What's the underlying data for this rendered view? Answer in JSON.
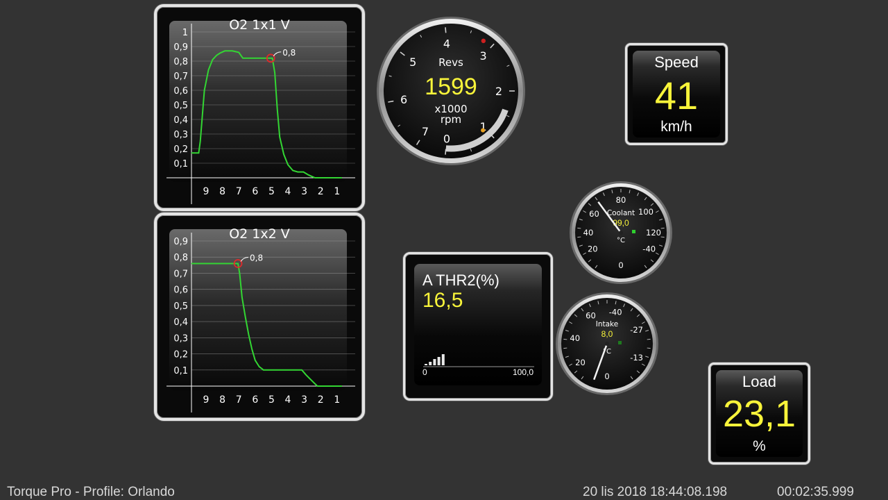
{
  "o2_chart_1": {
    "title": "O2 1x1  V",
    "y_ticks": [
      "1",
      "0,9",
      "0,8",
      "0,7",
      "0,6",
      "0,5",
      "0,4",
      "0,3",
      "0,2",
      "0,1"
    ],
    "x_ticks": [
      "9",
      "8",
      "7",
      "6",
      "5",
      "4",
      "3",
      "2",
      "1"
    ],
    "marker_label": "0,8",
    "line_color": "#33d633"
  },
  "o2_chart_2": {
    "title": "O2 1x2  V",
    "y_ticks": [
      "0,9",
      "0,8",
      "0,7",
      "0,6",
      "0,5",
      "0,4",
      "0,3",
      "0,2",
      "0,1"
    ],
    "x_ticks": [
      "9",
      "8",
      "7",
      "6",
      "5",
      "4",
      "3",
      "2",
      "1"
    ],
    "marker_label": "0,8",
    "line_color": "#33d633"
  },
  "chart_data": [
    {
      "type": "line",
      "title": "O2 1x1  V",
      "ylim": [
        0,
        1
      ],
      "xlim": [
        9.5,
        0.5
      ],
      "x": [
        9.9,
        9.45,
        9.35,
        9.1,
        8.85,
        8.6,
        8.35,
        8.15,
        7.85,
        7.6,
        7.4,
        7.0,
        6.75,
        5.95,
        5.05,
        4.95,
        4.8,
        4.65,
        4.5,
        4.25,
        4.0,
        3.7,
        3.4,
        3.05,
        2.75,
        2.55,
        2.35,
        2.0,
        1.5,
        0.7
      ],
      "y": [
        0.17,
        0.17,
        0.25,
        0.6,
        0.74,
        0.81,
        0.84,
        0.855,
        0.87,
        0.87,
        0.87,
        0.86,
        0.82,
        0.82,
        0.82,
        0.82,
        0.72,
        0.47,
        0.28,
        0.16,
        0.09,
        0.05,
        0.04,
        0.04,
        0.02,
        0.01,
        0.0,
        0.0,
        0.0,
        0.0
      ]
    },
    {
      "type": "line",
      "title": "O2 1x2  V",
      "ylim": [
        0,
        0.9
      ],
      "xlim": [
        9.5,
        0.5
      ],
      "x": [
        9.9,
        7.15,
        7.05,
        6.95,
        6.8,
        6.6,
        6.4,
        6.2,
        6.0,
        5.75,
        5.55,
        5.5,
        5.25,
        4.25,
        3.55,
        3.15,
        2.9,
        2.7,
        2.4,
        2.2,
        1.5,
        0.7
      ],
      "y": [
        0.76,
        0.76,
        0.76,
        0.7,
        0.55,
        0.43,
        0.32,
        0.23,
        0.16,
        0.12,
        0.105,
        0.1,
        0.1,
        0.1,
        0.1,
        0.1,
        0.07,
        0.05,
        0.02,
        0.0,
        0.0,
        0.0
      ]
    }
  ],
  "revs_gauge": {
    "title": "Revs",
    "value": "1599",
    "unit_line1": "x1000",
    "unit_line2": "rpm",
    "ticks": [
      "0",
      "1",
      "2",
      "3",
      "4",
      "5",
      "6",
      "7"
    ],
    "value_number": 1.599
  },
  "speed_display": {
    "label": "Speed",
    "value": "41",
    "unit": "km/h"
  },
  "coolant_gauge": {
    "title": "Coolant",
    "value": "99,0",
    "unit": "°C",
    "ticks": [
      "0",
      "20",
      "40",
      "60",
      "80",
      "100",
      "120",
      "-40"
    ],
    "value_number": 99.0
  },
  "intake_gauge": {
    "title": "Intake",
    "value": "8,0",
    "unit": "°C",
    "ticks": [
      "0",
      "20",
      "40",
      "60",
      "-40",
      "-27",
      "-13"
    ],
    "value_number": 8.0
  },
  "throttle_display": {
    "label": "A THR2(%)",
    "value": "16,5",
    "min": "0",
    "max": "100,0",
    "value_number": 16.5
  },
  "load_display": {
    "label": "Load",
    "value": "23,1",
    "unit": "%"
  },
  "status_bar": {
    "app_profile": "Torque Pro - Profile: Orlando",
    "datetime": "20 lis 2018 18:44:08.198",
    "elapsed": "00:02:35.999"
  }
}
